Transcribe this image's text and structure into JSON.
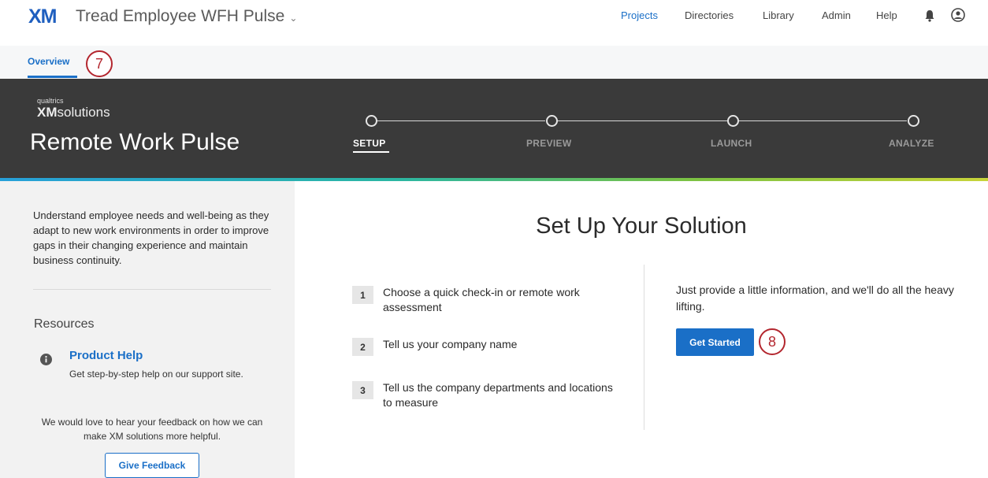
{
  "topbar": {
    "logo": "XM",
    "project_title": "Tread Employee WFH Pulse",
    "nav": [
      "Projects",
      "Directories",
      "Library",
      "Admin",
      "Help"
    ]
  },
  "tabs": {
    "overview": "Overview"
  },
  "callouts": {
    "first": "7",
    "second": "8"
  },
  "hero": {
    "brand_small": "qualtrics",
    "brand_xm": "XM",
    "brand_word": "solutions",
    "title": "Remote Work Pulse",
    "steps": [
      "SETUP",
      "PREVIEW",
      "LAUNCH",
      "ANALYZE"
    ]
  },
  "sidebar": {
    "description": "Understand employee needs and well-being as they adapt to new work environments in order to improve gaps in their changing experience and maintain business continuity.",
    "resources": "Resources",
    "help_title": "Product Help",
    "help_subtitle": "Get step-by-step help on our support site.",
    "feedback_text": "We would love to hear your feedback on how we can make XM solutions more helpful.",
    "feedback_button": "Give Feedback"
  },
  "main": {
    "title": "Set Up Your Solution",
    "steps": [
      {
        "num": "1",
        "text": "Choose a quick check-in or remote work assessment"
      },
      {
        "num": "2",
        "text": "Tell us your company name"
      },
      {
        "num": "3",
        "text": "Tell us the company departments and locations to measure"
      }
    ],
    "right_text": "Just provide a little information, and we'll do all the heavy lifting.",
    "cta": "Get Started"
  },
  "colors": {
    "accent": "#1a6fc7",
    "hero_bg": "#3a3a3a",
    "callout": "#b3262e"
  }
}
